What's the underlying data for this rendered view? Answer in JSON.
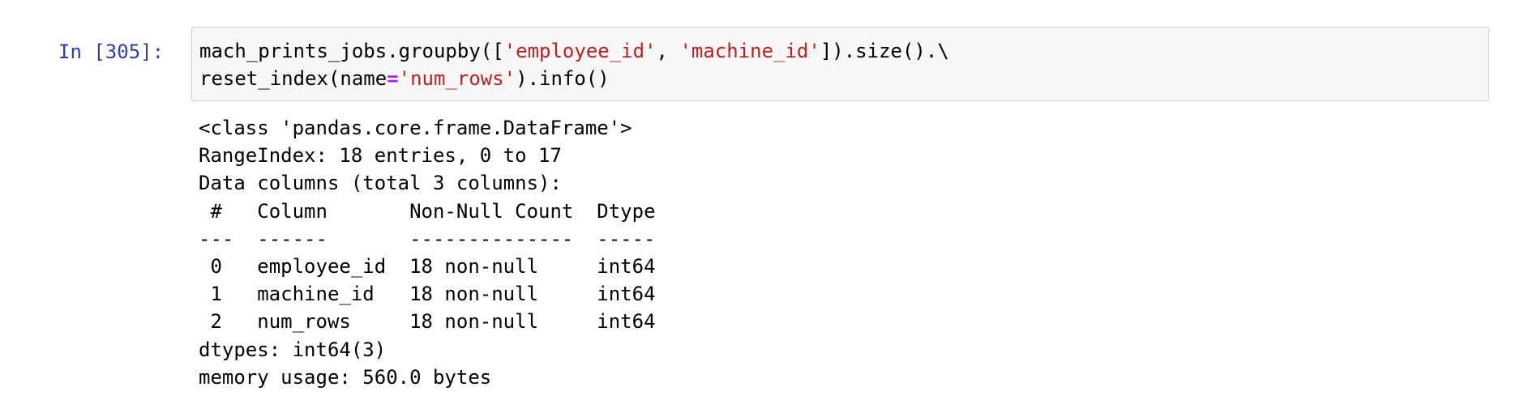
{
  "cell": {
    "prompt": "In [305]:",
    "code_lines": [
      [
        {
          "t": "mach_prints_jobs.groupby([",
          "k": "plain"
        },
        {
          "t": "'employee_id'",
          "k": "str"
        },
        {
          "t": ", ",
          "k": "plain"
        },
        {
          "t": "'machine_id'",
          "k": "str"
        },
        {
          "t": "]).size().\\",
          "k": "plain"
        }
      ],
      [
        {
          "t": "reset_index(name",
          "k": "plain"
        },
        {
          "t": "=",
          "k": "op"
        },
        {
          "t": "'num_rows'",
          "k": "str"
        },
        {
          "t": ").info()",
          "k": "plain"
        }
      ]
    ],
    "output_lines": [
      "<class 'pandas.core.frame.DataFrame'>",
      "RangeIndex: 18 entries, 0 to 17",
      "Data columns (total 3 columns):",
      " #   Column       Non-Null Count  Dtype",
      "---  ------       --------------  -----",
      " 0   employee_id  18 non-null     int64",
      " 1   machine_id   18 non-null     int64",
      " 2   num_rows     18 non-null     int64",
      "dtypes: int64(3)",
      "memory usage: 560.0 bytes"
    ]
  },
  "colors": {
    "prompt": "#303f9f",
    "string": "#ba2121",
    "operator": "#aa22ff",
    "input_background": "#f7f7f7",
    "input_border": "#cfcfcf"
  }
}
